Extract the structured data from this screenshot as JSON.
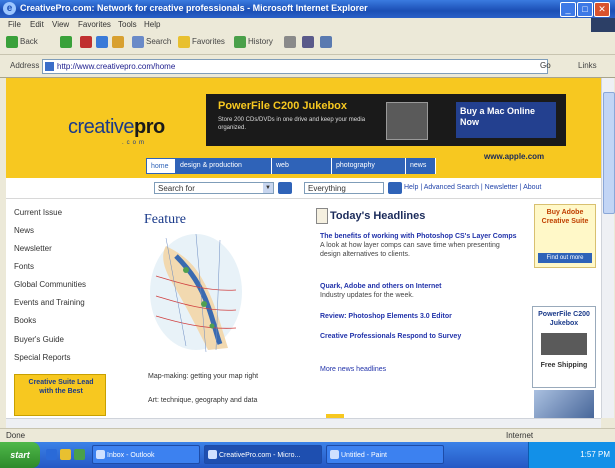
{
  "window": {
    "title": "CreativePro.com: Network for creative professionals - Microsoft Internet Explorer",
    "min": "_",
    "max": "□",
    "close": "✕"
  },
  "menu": [
    "File",
    "Edit",
    "View",
    "Favorites",
    "Tools",
    "Help"
  ],
  "toolbar": {
    "back": "Back",
    "search": "Search",
    "favorites": "Favorites",
    "history": "History"
  },
  "address": {
    "label": "Address",
    "url": "http://www.creativepro.com/home",
    "go": "Go",
    "links": "Links"
  },
  "site": {
    "logo_main": "creative",
    "logo_pro": "pro",
    "logo_sub": ".com",
    "banner_head": "PowerFile C200 Jukebox",
    "banner_copy": "Store 200 CDs/DVDs in one drive and keep your media organized.",
    "banner_cta": "Buy a Mac Online Now",
    "header_link": "www.apple.com",
    "tabs": [
      "home",
      "design & production",
      "web",
      "photography",
      "news"
    ]
  },
  "search": {
    "select1": "Search for",
    "select2": "Everything",
    "links": "Help | Advanced Search | Newsletter | About"
  },
  "leftnav": [
    "Current Issue",
    "News",
    "Newsletter",
    "Fonts",
    "Global Communities",
    "Events and Training",
    "Books",
    "Buyer's Guide",
    "Special Reports"
  ],
  "leftad": "Creative Suite Lead with the Best",
  "feature": {
    "heading": "Feature",
    "caption": "Map-making: getting your map right",
    "links": "Art: technique, geography and data"
  },
  "news": {
    "title": "Today's Headlines",
    "items": [
      {
        "link": "The benefits of working with Photoshop CS's Layer Comps",
        "text": "A look at how layer comps can save time when presenting design alternatives to clients."
      },
      {
        "link": "Quark, Adobe and others on Internet",
        "text": "Industry updates for the week."
      },
      {
        "link": "Review: Photoshop Elements 3.0 Editor",
        "text": ""
      },
      {
        "link": "Creative Professionals Respond to Survey",
        "text": ""
      }
    ],
    "more": "More news headlines"
  },
  "rightads": {
    "ad1_title": "Buy Adobe Creative Suite",
    "ad1_btn": "Find out more",
    "ad2_title": "PowerFile C200 Jukebox",
    "ad2_bottom": "Free Shipping"
  },
  "status": {
    "text": "Done",
    "zone": "Internet"
  },
  "taskbar": {
    "start": "start",
    "buttons": [
      "Inbox - Outlook",
      "CreativePro.com - Micro...",
      "Untitled - Paint"
    ],
    "clock": "1:57 PM"
  }
}
